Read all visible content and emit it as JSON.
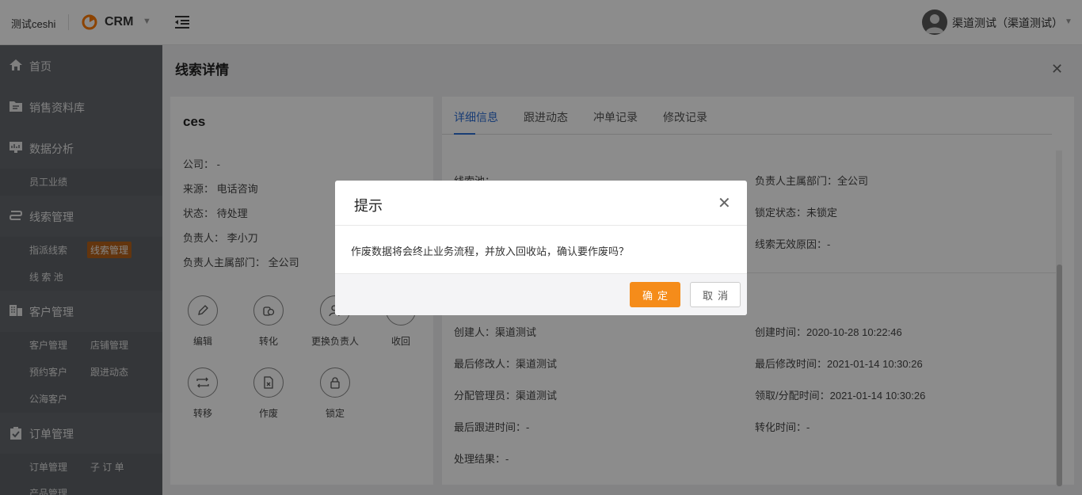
{
  "header": {
    "tenant": "测试ceshi",
    "app_name": "CRM",
    "user": "渠道测试（渠道测试）"
  },
  "sidebar": {
    "home": "首页",
    "sales_library": "销售资料库",
    "data_analysis": "数据分析",
    "employee_performance": "员工业绩",
    "lead_mgmt": "线索管理",
    "assign_leads": "指派线索",
    "lead_mgmt_sub": "线索管理",
    "lead_pool": "线 索 池",
    "customer_mgmt": "客户管理",
    "customer_mgmt_sub": "客户管理",
    "store_mgmt": "店铺管理",
    "reserved_customers": "预约客户",
    "follow_activity": "跟进动态",
    "sea_customers": "公海客户",
    "order_mgmt": "订单管理",
    "order_mgmt_sub": "订单管理",
    "sub_orders": "子 订 单",
    "product_mgmt": "产品管理"
  },
  "page": {
    "title": "线索详情"
  },
  "lead": {
    "name": "ces",
    "company_label": "公司：",
    "company": "-",
    "source_label": "来源：",
    "source": "电话咨询",
    "status_label": "状态：",
    "status": "待处理",
    "owner_label": "负责人：",
    "owner": "李小刀",
    "dept_label": "负责人主属部门：",
    "dept": "全公司"
  },
  "actions": {
    "edit": "编辑",
    "convert": "转化",
    "change_owner": "更换负责人",
    "reclaim": "收回",
    "transfer": "转移",
    "void": "作废",
    "lock": "锁定"
  },
  "tabs": [
    "详细信息",
    "跟进动态",
    "冲单记录",
    "修改记录"
  ],
  "details": {
    "pool_label": "线索池：",
    "owner_dept": "负责人主属部门：全公司",
    "lock_status": "锁定状态：未锁定",
    "invalid_reason": "线索无效原因：-",
    "creator": "创建人：渠道测试",
    "created_time": "创建时间：2020-10-28 10:22:46",
    "last_modifier": "最后修改人：渠道测试",
    "last_modified_time": "最后修改时间：2021-01-14 10:30:26",
    "assign_admin": "分配管理员：渠道测试",
    "claim_time": "领取/分配时间：2021-01-14 10:30:26",
    "last_follow_time": "最后跟进时间：-",
    "convert_time": "转化时间：-",
    "result": "处理结果：-"
  },
  "dialog": {
    "title": "提示",
    "message": "作废数据将会终止业务流程，并放入回收站，确认要作废吗？",
    "ok": "确定",
    "cancel": "取消"
  }
}
